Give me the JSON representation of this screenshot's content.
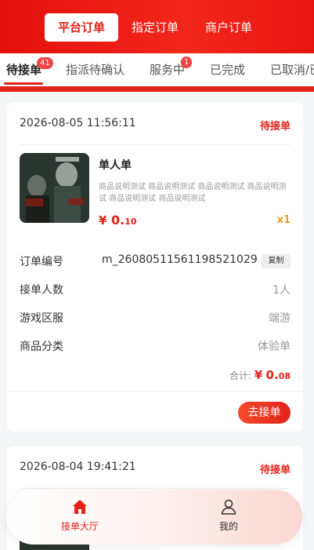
{
  "segments": [
    {
      "label": "平台订单",
      "active": true
    },
    {
      "label": "指定订单",
      "active": false
    },
    {
      "label": "商户订单",
      "active": false
    }
  ],
  "tabs": [
    {
      "label": "待接单",
      "badge": "41",
      "active": true
    },
    {
      "label": "指派待确认",
      "badge": "",
      "active": false
    },
    {
      "label": "服务中",
      "badge": "1",
      "active": false
    },
    {
      "label": "已完成",
      "badge": "",
      "active": false
    },
    {
      "label": "已取消/已",
      "badge": "",
      "active": false
    }
  ],
  "orders": [
    {
      "datetime": "2026-08-05 11:56:11",
      "status": "待接单",
      "product": {
        "title": "单人单",
        "description": "商品说明测试 商品说明测试 商品说明测试 商品说明测试 商品说明测试 商品说明测试",
        "price_symbol": "¥",
        "price_int": "0.",
        "price_dec": "10",
        "quantity": "x1"
      },
      "fields": {
        "order_no_label": "订单编号",
        "order_no": "m_26080511561198521029",
        "copy_label": "复制",
        "people_label": "接单人数",
        "people_value": "1人",
        "server_label": "游戏区服",
        "server_value": "端游",
        "category_label": "商品分类",
        "category_value": "体验单"
      },
      "total_label": "合计:",
      "total_symbol": "¥",
      "total_int": "0.",
      "total_dec": "08",
      "action_label": "去接单"
    },
    {
      "datetime": "2026-08-04 19:41:21",
      "status": "待接单"
    }
  ],
  "bottom_nav": [
    {
      "label": "接单大厅",
      "icon": "home-icon",
      "active": true
    },
    {
      "label": "我的",
      "icon": "user-icon",
      "active": false
    }
  ],
  "colors": {
    "accent": "#e3231a",
    "quantity": "#e8a21a",
    "badge": "#ef4444"
  }
}
